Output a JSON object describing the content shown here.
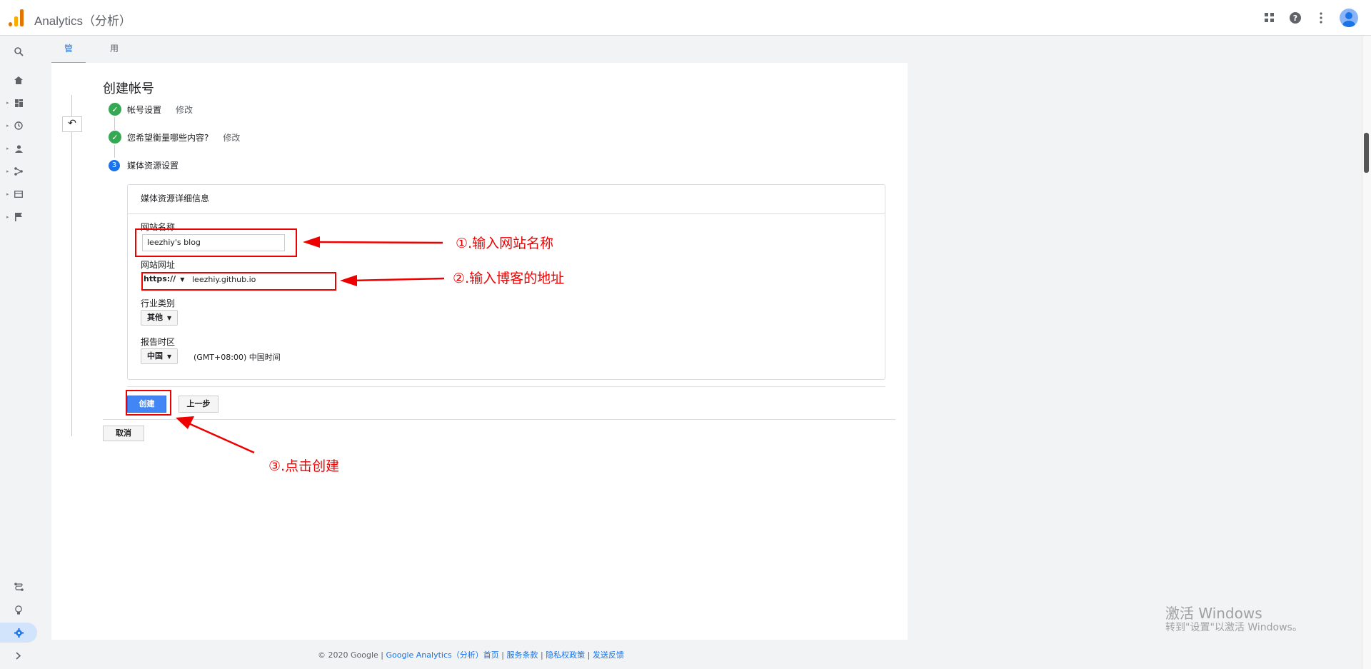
{
  "app": {
    "title": "Analytics（分析）"
  },
  "tabs": [
    {
      "label": "管理"
    },
    {
      "label": "用户"
    }
  ],
  "page": {
    "title": "创建帐号",
    "steps": [
      {
        "label": "帐号设置",
        "edit": "修改"
      },
      {
        "label": "您希望衡量哪些内容?",
        "edit": "修改"
      },
      {
        "number": "3",
        "label": "媒体资源设置"
      }
    ]
  },
  "form": {
    "card_title": "媒体资源详细信息",
    "site_name_label": "网站名称",
    "site_name_value": "leezhiy's blog",
    "site_url_label": "网站网址",
    "protocol": "https://",
    "site_url_value": "leezhiy.github.io",
    "industry_label": "行业类别",
    "industry_value": "其他",
    "timezone_label": "报告时区",
    "country_value": "中国",
    "timezone_value": "(GMT+08:00) 中国时间"
  },
  "buttons": {
    "create": "创建",
    "previous": "上一步",
    "cancel": "取消"
  },
  "annotations": [
    "①.输入网站名称",
    "②.输入博客的地址",
    "③.点击创建"
  ],
  "footer": {
    "copyright": "© 2020 Google | ",
    "links": [
      "Google Analytics（分析）首页",
      "服务条款",
      "隐私权政策",
      "发送反馈"
    ],
    "sep": " | "
  },
  "watermark": {
    "line1": "激活 Windows",
    "line2": "转到\"设置\"以激活 Windows。"
  },
  "colors": {
    "accent": "#1a73e8",
    "tab_underline": "#ff9800",
    "check": "#34a853",
    "annotation": "#ee0000",
    "logo_orange": "#f9ab00",
    "logo_dark": "#e37400"
  },
  "icons": [
    "search-icon",
    "home-icon",
    "dashboard-icon",
    "clock-icon",
    "person-icon",
    "acquisition-icon",
    "behavior-icon",
    "flag-icon",
    "attribution-icon",
    "lightbulb-icon",
    "gear-icon",
    "expand-icon",
    "apps-icon",
    "help-icon",
    "more-icon",
    "back-arrow-icon",
    "check-icon"
  ]
}
